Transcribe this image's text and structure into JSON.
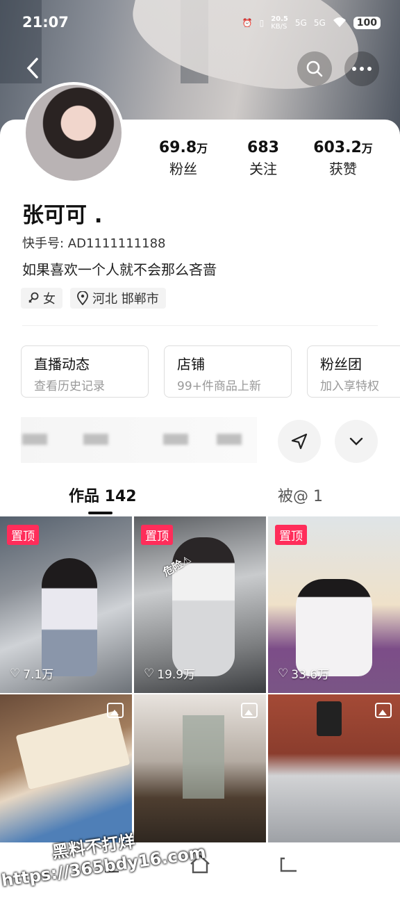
{
  "status_bar": {
    "time": "21:07",
    "net_speed_top": "20.5",
    "net_speed_unit": "KB/S",
    "signal_1": "5G",
    "signal_2": "5G",
    "battery": "100"
  },
  "profile": {
    "name": "张可可  .",
    "kuaishou_id": "快手号: AD1111111188",
    "bio": "如果喜欢一个人就不会那么吝啬",
    "gender": "女",
    "location": "河北 邯郸市"
  },
  "stats": [
    {
      "value": "69.8",
      "unit": "万",
      "label": "粉丝"
    },
    {
      "value": "683",
      "unit": "",
      "label": "关注"
    },
    {
      "value": "603.2",
      "unit": "万",
      "label": "获赞"
    }
  ],
  "cards": [
    {
      "title": "直播动态",
      "sub": "查看历史记录"
    },
    {
      "title": "店铺",
      "sub": "99+件商品上新"
    },
    {
      "title": "粉丝团",
      "sub": "加入享特权"
    }
  ],
  "tabs": {
    "works": "作品 142",
    "mentioned": "被@ 1"
  },
  "grid": [
    {
      "pinned": "置顶",
      "likes": "7.1万",
      "type": "video"
    },
    {
      "pinned": "置顶",
      "likes": "19.9万",
      "type": "video",
      "sticker": "危险⚠"
    },
    {
      "pinned": "置顶",
      "likes": "33.6万",
      "type": "video"
    },
    {
      "pinned": "",
      "likes": "",
      "type": "image"
    },
    {
      "pinned": "",
      "likes": "",
      "type": "image"
    },
    {
      "pinned": "",
      "likes": "",
      "type": "image"
    }
  ],
  "watermark": {
    "line1": "黑料不打烊",
    "line2": "https://365bdy16.com"
  },
  "colors": {
    "pin": "#ff2d5a",
    "accent_text": "#111111"
  }
}
